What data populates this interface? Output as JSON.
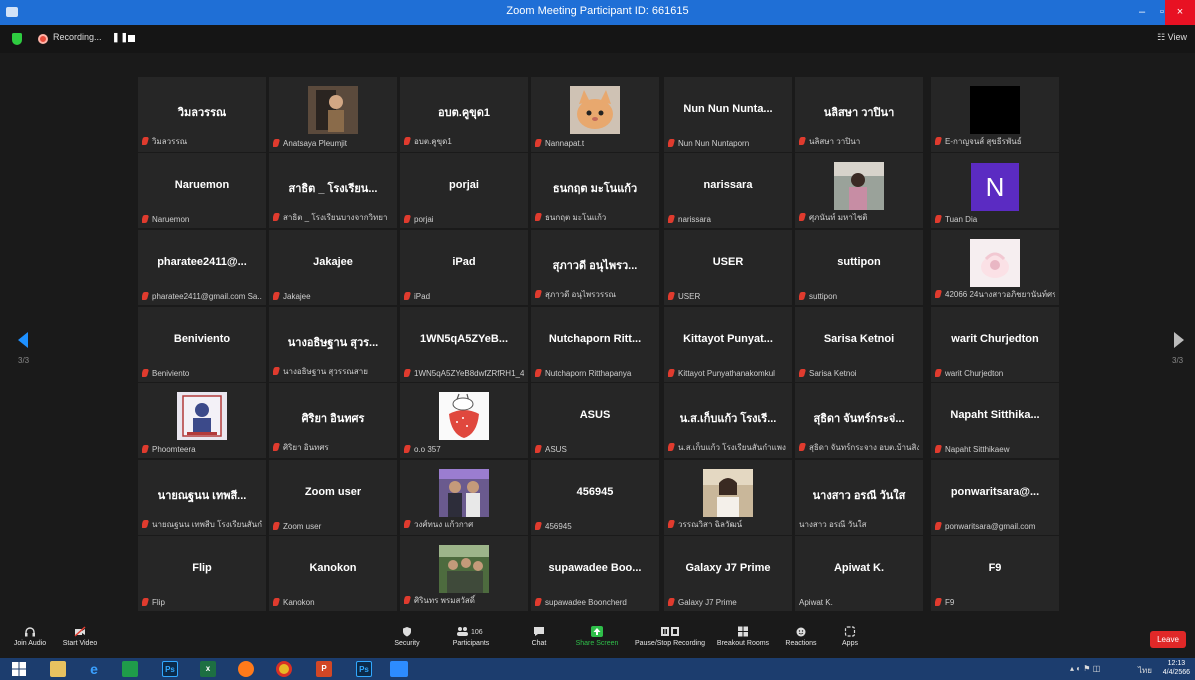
{
  "window": {
    "title": "Zoom Meeting Participant ID: 661615",
    "minimize": "–",
    "maximize": "▫",
    "close": "×"
  },
  "topbar": {
    "recording_label": "Recording...",
    "pause_glyph": "❚❚",
    "view_label": "☷ View"
  },
  "pagination": {
    "left_page": "3/3",
    "right_page": "3/3"
  },
  "tiles": [
    {
      "big": "วิมลวรรณ",
      "small": "วิมลวรรณ",
      "muted": true
    },
    {
      "big": "",
      "small": "Anatsaya Pleumjit",
      "muted": true,
      "pic": "photo-woman"
    },
    {
      "big": "อบต.คูขุด1",
      "small": "อบต.คูขุด1",
      "muted": true
    },
    {
      "big": "",
      "small": "Nannapat.t",
      "muted": true,
      "pic": "cat"
    },
    {
      "big": "Nun Nun Nunta...",
      "small": "Nun Nun Nuntaporn",
      "muted": true
    },
    {
      "big": "นลิสษา วาปินา",
      "small": "นลิสษา วาปินา",
      "muted": true
    },
    {
      "big": "",
      "small": "E-กาญจนส์ สุขธีรพันธ์",
      "muted": true,
      "pic": "black"
    },
    {
      "big": "Naruemon",
      "small": "Naruemon",
      "muted": true
    },
    {
      "big": "สาธิต _ โรงเรียน...",
      "small": "สาธิต _ โรงเรียนบางจากวิทยา",
      "muted": true
    },
    {
      "big": "porjai",
      "small": "porjai",
      "muted": true
    },
    {
      "big": "ธนกฤต มะโนแก้ว",
      "small": "ธนกฤต มะโนแก้ว",
      "muted": true
    },
    {
      "big": "narissara",
      "small": "narissara",
      "muted": true
    },
    {
      "big": "",
      "small": "ศุภนันท์ มหาไชติ",
      "muted": true,
      "pic": "photo-girl"
    },
    {
      "big": "",
      "small": "Tuan Dia",
      "muted": true,
      "pic": "avatar-N",
      "avatar_letter": "N"
    },
    {
      "big": "pharatee2411@...",
      "small": "pharatee2411@gmail.com Sa...",
      "muted": true
    },
    {
      "big": "Jakajee",
      "small": "Jakajee",
      "muted": true
    },
    {
      "big": "iPad",
      "small": "iPad",
      "muted": true
    },
    {
      "big": "สุภาวดี อนุไพรว...",
      "small": "สุภาวดี อนุไพรวรรณ",
      "muted": true
    },
    {
      "big": "USER",
      "small": "USER",
      "muted": true
    },
    {
      "big": "suttipon",
      "small": "suttipon",
      "muted": true
    },
    {
      "big": "",
      "small": "42066 24นางสาวอภิชยานันท์ศรว...",
      "muted": true,
      "pic": "cake"
    },
    {
      "big": "Beniviento",
      "small": "Beniviento",
      "muted": true
    },
    {
      "big": "นางอธิษฐาน สุวร...",
      "small": "นางอธิษฐาน สุวรรณสาย",
      "muted": true
    },
    {
      "big": "1WN5qA5ZYeB...",
      "small": "1WN5qA5ZYeB8dwfZRfRH1_40...",
      "muted": true
    },
    {
      "big": "Nutchaporn Ritt...",
      "small": "Nutchaporn Ritthapanya",
      "muted": true
    },
    {
      "big": "Kittayot Punyat...",
      "small": "Kittayot Punyathanakomkul",
      "muted": true
    },
    {
      "big": "Sarisa Ketnoi",
      "small": "Sarisa Ketnoi",
      "muted": true
    },
    {
      "big": "warit Churjedton",
      "small": "warit Churjedton",
      "muted": true
    },
    {
      "big": "",
      "small": "Phoomteera",
      "muted": true,
      "pic": "poster"
    },
    {
      "big": "ศิริยา อินทศร",
      "small": "ศิริยา อินทศร",
      "muted": true
    },
    {
      "big": "",
      "small": "o.o 357",
      "muted": true,
      "pic": "strawberry"
    },
    {
      "big": "ASUS",
      "small": "ASUS",
      "muted": true
    },
    {
      "big": "น.ส.เก็บแก้ว โรงเรี...",
      "small": "น.ส.เก็บแก้ว โรงเรียนสันกำแพง",
      "muted": true
    },
    {
      "big": "สุธิดา จันทร์กระจ่...",
      "small": "สุธิดา จันทร์กระจาง อบต.บ้านสิงห์ ...",
      "muted": true
    },
    {
      "big": "Napaht Sitthika...",
      "small": "Napaht Sitthikaew",
      "muted": true
    },
    {
      "big": "นายณฐนน เทพสี...",
      "small": "นายณฐนน เทพสีบ โรงเรียนสันกำแ...",
      "muted": true
    },
    {
      "big": "Zoom user",
      "small": "Zoom user",
      "muted": true
    },
    {
      "big": "",
      "small": "วงศ์ทนง แก้วกาศ",
      "muted": true,
      "pic": "photo-men"
    },
    {
      "big": "456945",
      "small": "456945",
      "muted": true
    },
    {
      "big": "",
      "small": "วรรณวิสา ฉิลวัฒน์",
      "muted": true,
      "pic": "photo-lady"
    },
    {
      "big": "นางสาว อรณี วันใส",
      "small": "นางสาว อรณี วันใส",
      "muted": false
    },
    {
      "big": "ponwaritsara@...",
      "small": "ponwaritsara@gmail.com",
      "muted": true
    },
    {
      "big": "Flip",
      "small": "Flip",
      "muted": true
    },
    {
      "big": "Kanokon",
      "small": "Kanokon",
      "muted": true
    },
    {
      "big": "",
      "small": "ศิรินทร พรมสวัสดิ์",
      "muted": true,
      "pic": "photo-group"
    },
    {
      "big": "supawadee Boo...",
      "small": "supawadee Booncherd",
      "muted": true
    },
    {
      "big": "Galaxy J7 Prime",
      "small": "Galaxy J7 Prime",
      "muted": true
    },
    {
      "big": "Apiwat K.",
      "small": "Apiwat K.",
      "muted": false
    },
    {
      "big": "F9",
      "small": "F9",
      "muted": true
    }
  ],
  "toolbar": {
    "join_audio": "Join Audio",
    "start_video": "Start Video",
    "security": "Security",
    "participants": "Participants",
    "participants_count": "106",
    "chat": "Chat",
    "share_screen": "Share Screen",
    "pause_stop_recording": "Pause/Stop Recording",
    "breakout_rooms": "Breakout Rooms",
    "reactions": "Reactions",
    "apps": "Apps",
    "leave": "Leave"
  },
  "taskbar": {
    "apps": [
      "windows-start",
      "file-explorer",
      "internet-explorer",
      "store",
      "photoshop",
      "excel",
      "firefox",
      "chrome",
      "powerpoint",
      "photoshop",
      "zoom"
    ],
    "excel_label": "x",
    "ps_label": "Ps",
    "pp_label": "P",
    "time": "12:13",
    "date": "4/4/2566",
    "lang": "ไทย"
  },
  "colors": {
    "accent": "#1f6fd6",
    "leave": "#e02828",
    "share": "#2fbf4a",
    "taskbar": "#1c3d6e"
  }
}
